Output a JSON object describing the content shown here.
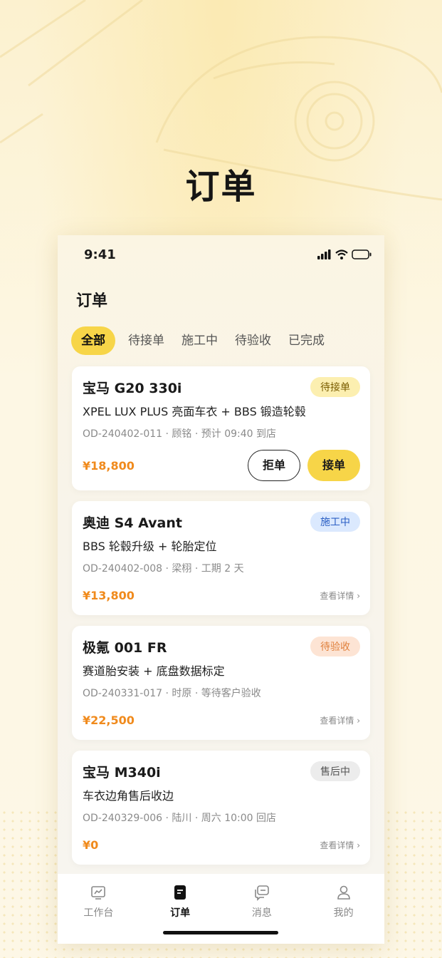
{
  "hero_title": "订单",
  "status": {
    "time": "9:41"
  },
  "page_title": "订单",
  "tabs": [
    {
      "label": "全部",
      "active": true
    },
    {
      "label": "待接单",
      "active": false
    },
    {
      "label": "施工中",
      "active": false
    },
    {
      "label": "待验收",
      "active": false
    },
    {
      "label": "已完成",
      "active": false
    }
  ],
  "orders": [
    {
      "car": "宝马 G20 330i",
      "badge": "待接单",
      "service": "XPEL LUX PLUS 亮面车衣 + BBS 锻造轮毂",
      "meta": "OD-240402-011 · 顾铭 · 预计 09:40 到店",
      "price": "¥18,800",
      "reject_label": "拒单",
      "accept_label": "接单"
    },
    {
      "car": "奥迪 S4 Avant",
      "badge": "施工中",
      "service": "BBS 轮毂升级 + 轮胎定位",
      "meta": "OD-240402-008 · 梁栩 · 工期 2 天",
      "price": "¥13,800",
      "detail_label": "查看详情 ›"
    },
    {
      "car": "极氪 001 FR",
      "badge": "待验收",
      "service": "赛道胎安装 + 底盘数据标定",
      "meta": "OD-240331-017 · 时原 · 等待客户验收",
      "price": "¥22,500",
      "detail_label": "查看详情 ›"
    },
    {
      "car": "宝马 M340i",
      "badge": "售后中",
      "service": "车衣边角售后收边",
      "meta": "OD-240329-006 · 陆川 · 周六 10:00 回店",
      "price": "¥0",
      "detail_label": "查看详情 ›"
    }
  ],
  "tabbar": [
    {
      "label": "工作台",
      "icon": "chart-icon"
    },
    {
      "label": "订单",
      "icon": "order-icon"
    },
    {
      "label": "消息",
      "icon": "message-icon"
    },
    {
      "label": "我的",
      "icon": "user-icon"
    }
  ],
  "colors": {
    "accent": "#f7d548",
    "price": "#f08a1c"
  }
}
